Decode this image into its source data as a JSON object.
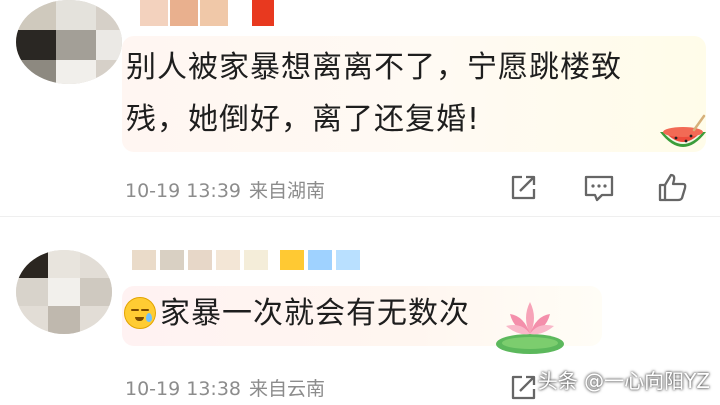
{
  "comments": [
    {
      "text": "别人被家暴想离离不了，宁愿跳楼致残，她倒好，离了还复婚!",
      "time": "10-19 13:39",
      "location": "来自湖南",
      "bubble_decoration": "watermelon-icon"
    },
    {
      "text": "家暴一次就会有无数次",
      "time": "10-19 13:38",
      "location": "来自云南",
      "leading_emoji": "sad-sweat-face-icon",
      "bubble_decoration": "lotus-icon"
    }
  ],
  "actions": [
    "forward-icon",
    "comment-icon",
    "like-icon"
  ],
  "watermark": "头条 @一心向阳YZ",
  "colors": {
    "meta_text": "#8c8c8c",
    "icon_stroke": "#666666"
  }
}
